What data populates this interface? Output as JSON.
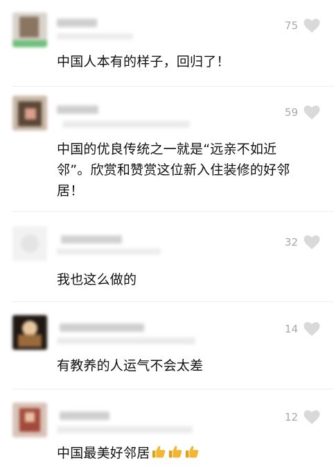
{
  "comments": [
    {
      "likes": "75",
      "text": "中国人本有的样子，回归了！",
      "emoji": []
    },
    {
      "likes": "59",
      "text": "中国的优良传统之一就是“远亲不如近邻”。欣赏和赞赏这位新入住装修的好邻居！",
      "emoji": []
    },
    {
      "likes": "32",
      "text": "我也这么做的",
      "emoji": []
    },
    {
      "likes": "14",
      "text": "有教养的人运气不会太差",
      "emoji": []
    },
    {
      "likes": "12",
      "text": "中国最美好邻居",
      "emoji": [
        "thumbs-up-icon",
        "thumbs-up-icon",
        "thumbs-up-icon"
      ]
    }
  ],
  "colors": {
    "heart": "#d9d9d9",
    "like_count": "#a8a8a8",
    "thumb": "#f2b632"
  }
}
